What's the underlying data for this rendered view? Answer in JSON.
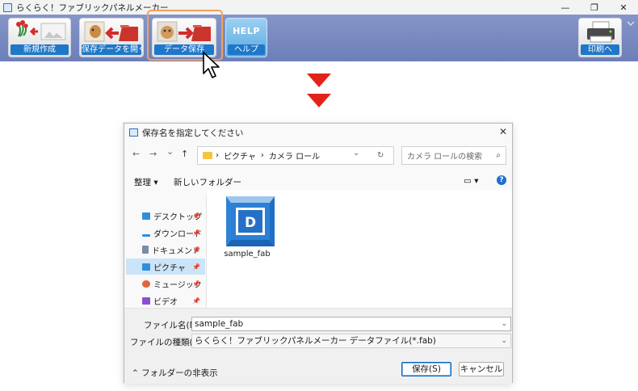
{
  "window": {
    "title": "らくらく！ファブリックパネルメーカー",
    "minimize": "—",
    "restore": "❐",
    "close": "✕"
  },
  "toolbar": {
    "new": "新規作成",
    "open": "保存データを開く",
    "save": "データ保存",
    "help_art": "HELP",
    "help": "ヘルプ",
    "print": "印刷へ"
  },
  "dialog": {
    "title": "保存名を指定してください",
    "close": "✕",
    "nav": {
      "back": "←",
      "forward": "→",
      "dropdown": "⌄",
      "up": "↑"
    },
    "path": {
      "sep1": "›",
      "seg1": "ピクチャ",
      "sep2": "›",
      "seg2": "カメラ ロール",
      "dropdown": "⌄",
      "refresh": "↻"
    },
    "search": {
      "placeholder": "カメラ ロールの検索",
      "icon": "⌕"
    },
    "commands": {
      "organize": "整理 ▾",
      "new_folder": "新しいフォルダー",
      "view": "▭ ▾",
      "help": "?"
    },
    "sidebar": [
      {
        "label": "デスクトップ",
        "icon": "desktop-icon",
        "color": "#2f8fdc",
        "pin": "📌"
      },
      {
        "label": "ダウンロード",
        "icon": "download-icon",
        "color": "#2f8fdc",
        "pin": "📌"
      },
      {
        "label": "ドキュメント",
        "icon": "document-icon",
        "color": "#7b8ca8",
        "pin": "📌"
      },
      {
        "label": "ピクチャ",
        "icon": "pictures-icon",
        "color": "#2f8fdc",
        "pin": "📌"
      },
      {
        "label": "ミュージック",
        "icon": "music-icon",
        "color": "#e0663f",
        "pin": "📌"
      },
      {
        "label": "ビデオ",
        "icon": "video-icon",
        "color": "#8a4fd1",
        "pin": "📌"
      }
    ],
    "files": [
      {
        "name": "sample_fab",
        "letter": "D"
      }
    ],
    "filename_label": "ファイル名(N):",
    "filename_value": "sample_fab",
    "filetype_label": "ファイルの種類(T):",
    "filetype_value": "らくらく！ファブリックパネルメーカー データファイル(*.fab)",
    "field_arrow": "⌄",
    "hide_folders": "⌃ フォルダーの非表示",
    "save_button": "保存(S)",
    "cancel_button": "キャンセル"
  }
}
